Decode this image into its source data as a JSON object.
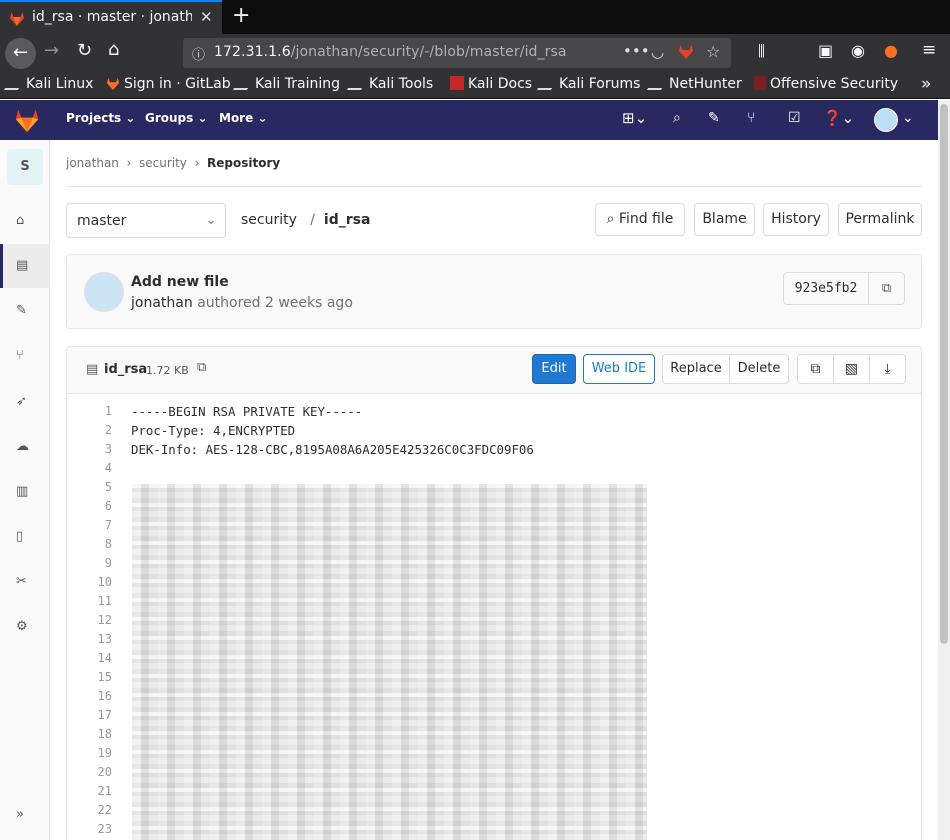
{
  "browser": {
    "tab_title": "id_rsa · master · jonathan",
    "url_host": "172.31.1.6",
    "url_path": "/jonathan/security/-/blob/master/id_rsa",
    "bookmarks": [
      "Kali Linux",
      "Sign in · GitLab",
      "Kali Training",
      "Kali Tools",
      "Kali Docs",
      "Kali Forums",
      "NetHunter",
      "Offensive Security"
    ]
  },
  "gitlab_nav": {
    "projects": "Projects",
    "groups": "Groups",
    "more": "More",
    "accent": "#292961"
  },
  "sidebar": {
    "project_initial": "S"
  },
  "breadcrumb": {
    "user": "jonathan",
    "project": "security",
    "current": "Repository"
  },
  "file_nav": {
    "branch": "master",
    "path_project": "security",
    "path_file": "id_rsa",
    "find_file": "Find file",
    "blame": "Blame",
    "history": "History",
    "permalink": "Permalink"
  },
  "commit": {
    "title": "Add new file",
    "author": "jonathan",
    "authored_text": "authored 2 weeks ago",
    "sha": "923e5fb2"
  },
  "file": {
    "name": "id_rsa",
    "size": "1.72 KB",
    "edit": "Edit",
    "web_ide": "Web IDE",
    "replace": "Replace",
    "delete": "Delete",
    "edit_color": "#1f78d1"
  },
  "code": {
    "line_numbers": "1\n2\n3\n4\n5\n6\n7\n8\n9\n10\n11\n12\n13\n14\n15\n16\n17\n18\n19\n20\n21\n22\n23",
    "text": "-----BEGIN RSA PRIVATE KEY-----\nProc-Type: 4,ENCRYPTED\nDEK-Info: AES-128-CBC,8195A08A6A205E425326C0C3FDC09F06"
  }
}
